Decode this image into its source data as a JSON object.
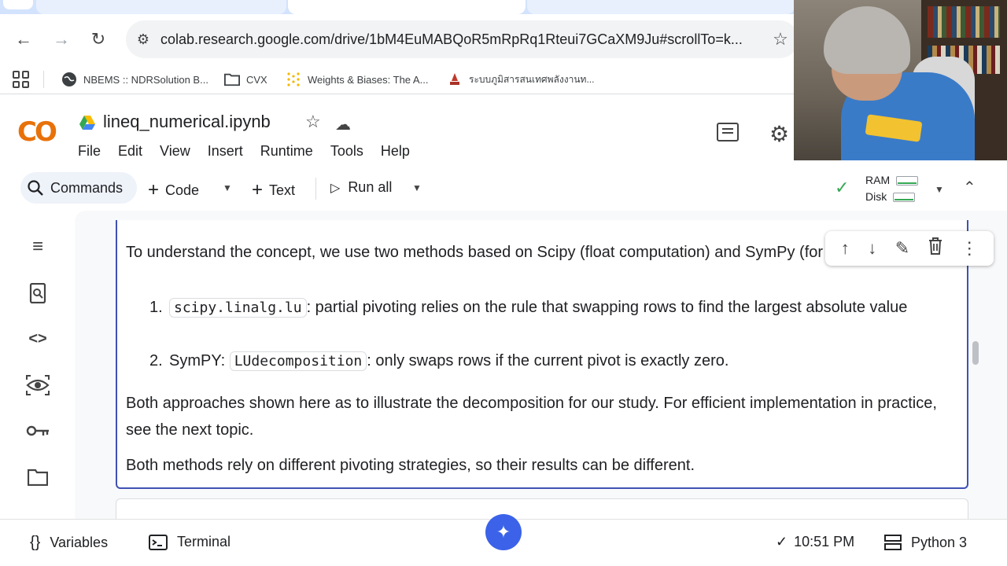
{
  "browser": {
    "url": "colab.research.google.com/drive/1bM4EuMABQoR5mRpRq1Rteui7GCaXM9Ju#scrollTo=k...",
    "bookmarks": [
      {
        "label": "NBEMS :: NDRSolution B...",
        "icon": "globe-icon"
      },
      {
        "label": "CVX",
        "icon": "folder-icon"
      },
      {
        "label": "Weights & Biases: The A...",
        "icon": "wandb-icon"
      },
      {
        "label": "ระบบภูมิสารสนเทศพลังงานท...",
        "icon": "energy-icon"
      }
    ]
  },
  "colab": {
    "notebook_title": "lineq_numerical.ipynb",
    "menu": [
      "File",
      "Edit",
      "View",
      "Insert",
      "Runtime",
      "Tools",
      "Help"
    ],
    "toolbar": {
      "commands": "Commands",
      "code": "Code",
      "text": "Text",
      "run_all": "Run all"
    },
    "resources": {
      "ram": "RAM",
      "disk": "Disk"
    }
  },
  "cell": {
    "para1": "To understand the concept, we use two methods based on Scipy (float computation) and SymPy (for study only).",
    "list": [
      {
        "num": "1.",
        "prefix": "",
        "code": "scipy.linalg.lu",
        "text": ": partial pivoting relies on the rule that swapping rows to find the largest absolute value"
      },
      {
        "num": "2.",
        "prefix": "SymPY: ",
        "code": "LUdecomposition",
        "text": ": only swaps rows if the current pivot is exactly zero."
      }
    ],
    "para2": "Both approaches shown here as to illustrate the decomposition for our study. For efficient implementation in practice, see the next topic.",
    "para3": "Both methods rely on different pivoting strategies, so their results can be different."
  },
  "statusbar": {
    "variables": "Variables",
    "terminal": "Terminal",
    "time": "10:51 PM",
    "runtime": "Python 3"
  },
  "colors": {
    "accent": "#3f51b5",
    "colab_orange": "#e8710a",
    "ok_green": "#34a853",
    "gemini_blue": "#3b62e8"
  }
}
